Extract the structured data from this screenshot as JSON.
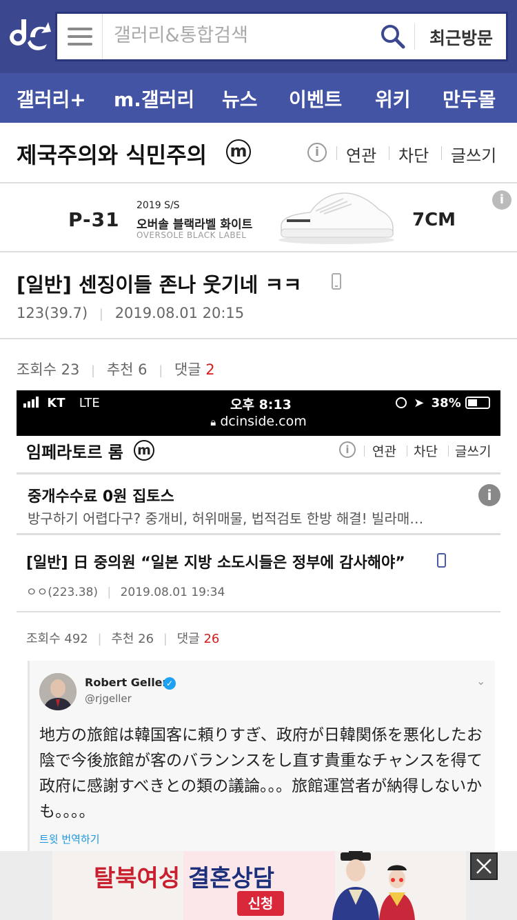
{
  "header": {
    "search_placeholder": "갤러리&통합검색",
    "recent_label": "최근방문"
  },
  "nav": [
    "갤러리+",
    "m.갤러리",
    "뉴스",
    "이벤트",
    "위키",
    "만두몰"
  ],
  "gallery": {
    "title": "제국주의와 식민주의",
    "badge": "m",
    "links": [
      "연관",
      "차단",
      "글쓰기"
    ]
  },
  "ad_top": {
    "brand": "P-31",
    "line1": "2019 S/S",
    "line2": "오버솔 블랙라벨 화이트",
    "line3": "OVERSOLE BLACK LABEL",
    "height": "7CM",
    "info": "i"
  },
  "post": {
    "title": "[일반] 센징이들 존나 웃기네 ㅋㅋ",
    "author": "123(39.7)",
    "date": "2019.08.01 20:15",
    "views_label": "조회수 23",
    "recommend_label": "추천 6",
    "comments_label": "댓글",
    "comments_count": "2"
  },
  "screenshot": {
    "status": {
      "carrier": "KT",
      "network": "LTE",
      "time": "오후 8:13",
      "battery": "38%",
      "url": "dcinside.com"
    },
    "gallery": {
      "title": "임페라토르 롬",
      "badge": "m",
      "links": [
        "연관",
        "차단",
        "글쓰기"
      ]
    },
    "ad": {
      "title": "중개수수료 0원 집토스",
      "desc": "방구하기 어렵다구? 중개비, 허위매물, 법적검토 한방 해결! 빌라매…"
    },
    "post": {
      "title": "[일반] 日 중의원 “일본 지방 소도시들은 정부에 감사해야”",
      "author": "ㅇㅇ(223.38)",
      "date": "2019.08.01 19:34",
      "views_label": "조회수 492",
      "recommend_label": "추천 26",
      "comments_label": "댓글",
      "comments_count": "26"
    },
    "tweet": {
      "name": "Robert Geller",
      "handle": "@rjgeller",
      "text": "地方の旅館は韓国客に頼りすぎ、政府が日韓関係を悪化したお陰で今後旅館が客のバランンスをし直す貴重なチャンスを得て政府に感謝すべきとの類の議論。。。旅館運営者が納得しないかも。。。。",
      "translate": "트윗 번역하기"
    }
  },
  "bottom_ad": {
    "headline_part1": "탈북여성",
    "headline_part2": "결혼상담",
    "button": "신청"
  },
  "colors": {
    "header_bg": "#3b4890",
    "nav_bg": "#4454a5",
    "comment_red": "#d71a1a"
  }
}
